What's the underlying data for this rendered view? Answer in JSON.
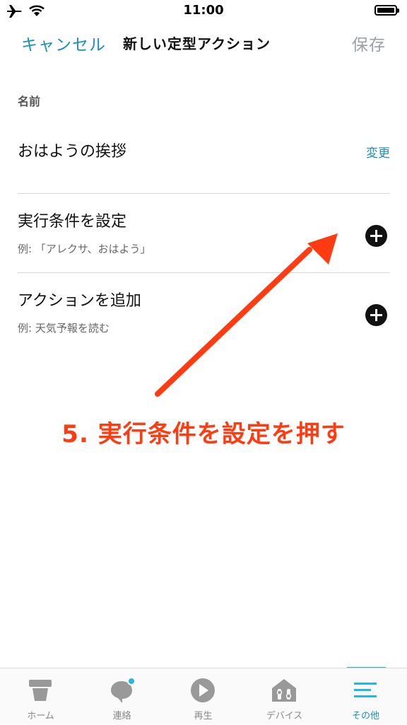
{
  "status_bar": {
    "time": "11:00",
    "icons": [
      "airplane-icon",
      "wifi-icon",
      "battery-icon"
    ]
  },
  "nav": {
    "cancel": "キャンセル",
    "title": "新しい定型アクション",
    "save": "保存"
  },
  "name_section": {
    "label": "名前",
    "value": "おはようの挨拶",
    "change": "変更"
  },
  "rows": [
    {
      "title": "実行条件を設定",
      "subtitle": "例: 「アレクサ、おはよう」",
      "icon": "plus-circle-icon"
    },
    {
      "title": "アクションを追加",
      "subtitle": "例: 天気予報を読む",
      "icon": "plus-circle-icon"
    }
  ],
  "annotation": {
    "text": "5. 実行条件を設定を押す",
    "color": "#ff3b12"
  },
  "tabs": [
    {
      "label": "ホーム",
      "icon": "home-icon",
      "active": false
    },
    {
      "label": "連絡",
      "icon": "chat-bubble-icon",
      "active": false
    },
    {
      "label": "再生",
      "icon": "play-icon",
      "active": false
    },
    {
      "label": "デバイス",
      "icon": "devices-icon",
      "active": false
    },
    {
      "label": "その他",
      "icon": "menu-icon",
      "active": true
    }
  ],
  "colors": {
    "accent": "#1a8fc0",
    "disabled": "#9aa0a6",
    "tab_indicator": "#22b8e0"
  }
}
